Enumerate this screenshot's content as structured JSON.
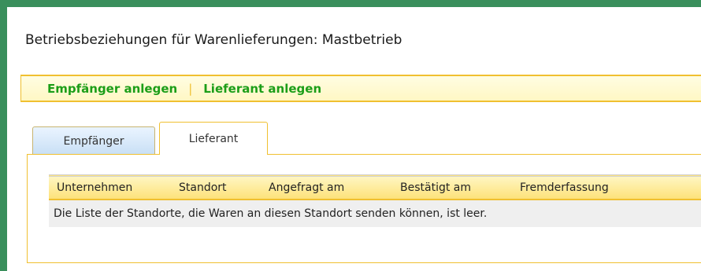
{
  "page": {
    "title": "Betriebsbeziehungen für Warenlieferungen: Mastbetrieb"
  },
  "actions": {
    "create_recipient": "Empfänger anlegen",
    "separator": "|",
    "create_supplier": "Lieferant anlegen"
  },
  "tabs": [
    {
      "label": "Empfänger",
      "active": false
    },
    {
      "label": "Lieferant",
      "active": true
    }
  ],
  "table": {
    "columns": [
      "Unternehmen",
      "Standort",
      "Angefragt am",
      "Bestätigt am",
      "Fremderfassung"
    ],
    "empty_message": "Die Liste der Standorte, die Waren an diesen Standort senden können, ist leer."
  },
  "colors": {
    "frame": "#3a8f5c",
    "accent": "#f0c030",
    "link": "#1c9e18"
  }
}
